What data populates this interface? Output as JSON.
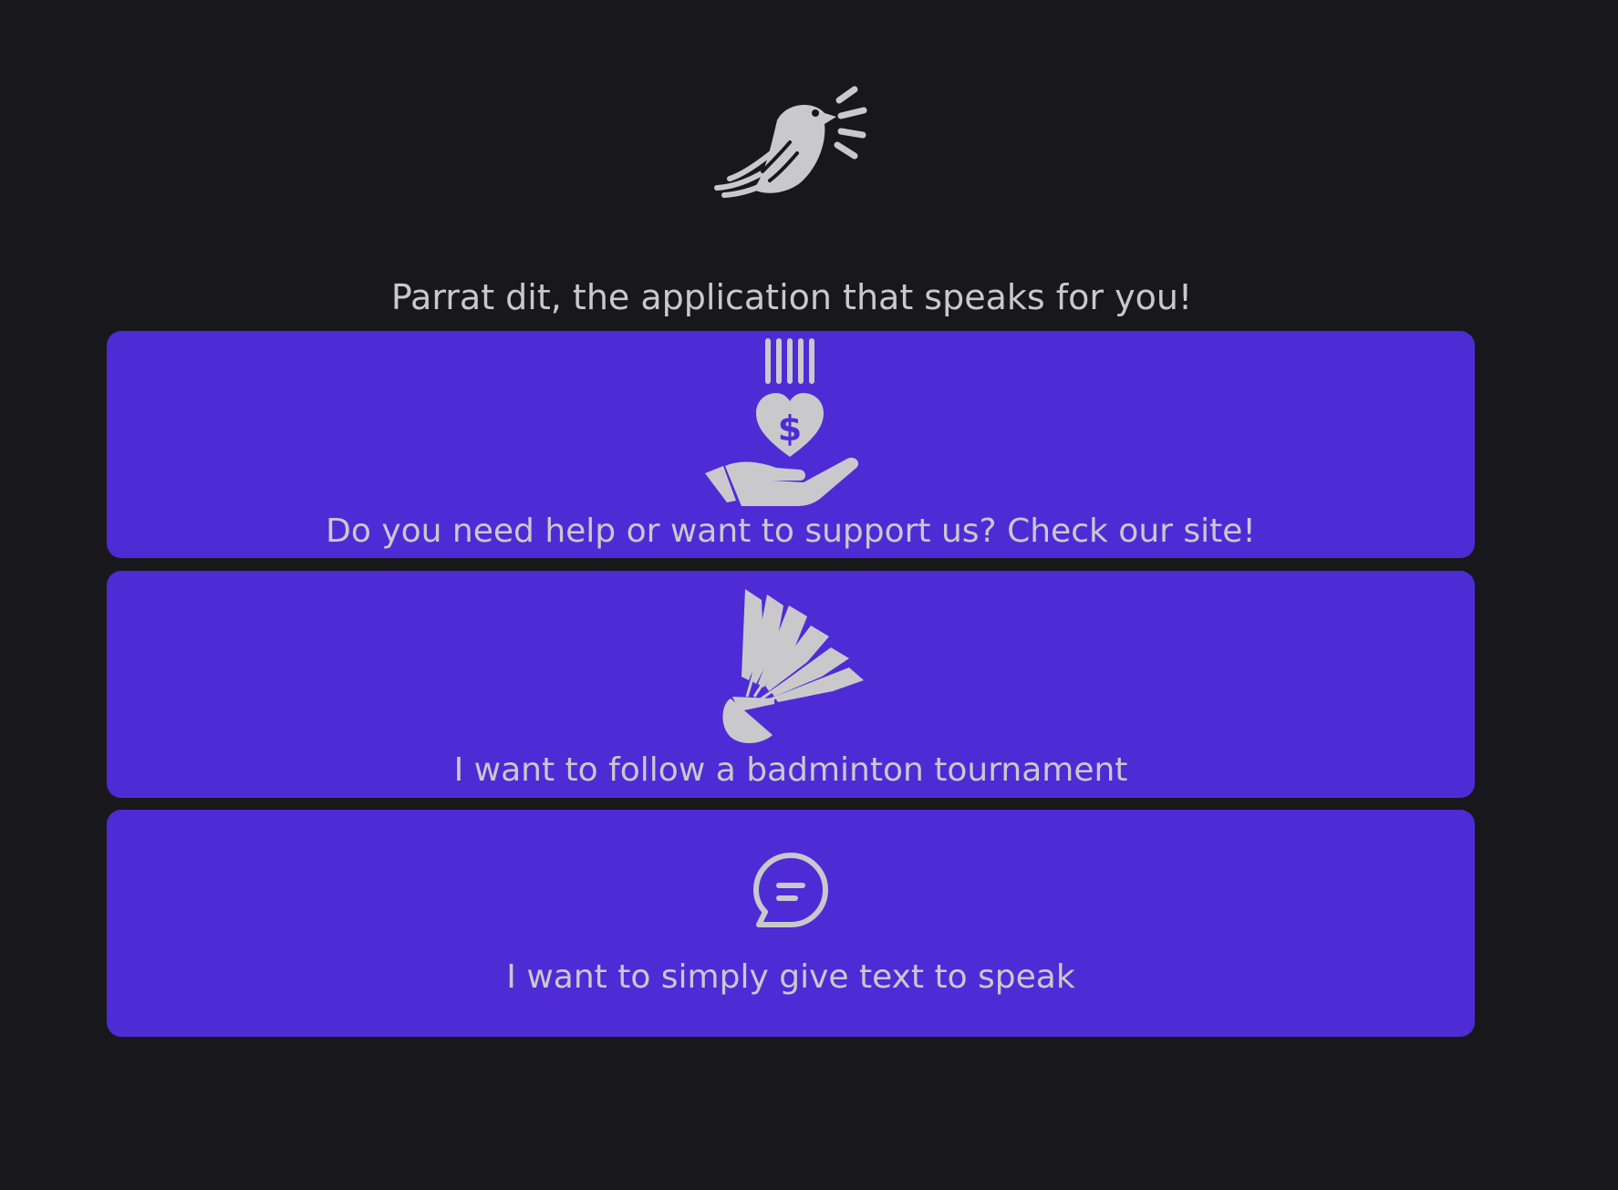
{
  "app": {
    "logo_icon": "parrot-speaking-icon",
    "tagline": "Parrat dit, the application that speaks for you!"
  },
  "colors": {
    "background": "#18181c",
    "card": "#4f2bd6",
    "foreground": "#c9c9cc"
  },
  "options": [
    {
      "icon": "donation-hand-heart-icon",
      "label": "Do you need help or want to support us? Check our site!"
    },
    {
      "icon": "shuttlecock-icon",
      "label": "I want to follow a badminton tournament"
    },
    {
      "icon": "chat-bubble-icon",
      "label": "I want to simply give text to speak"
    }
  ]
}
